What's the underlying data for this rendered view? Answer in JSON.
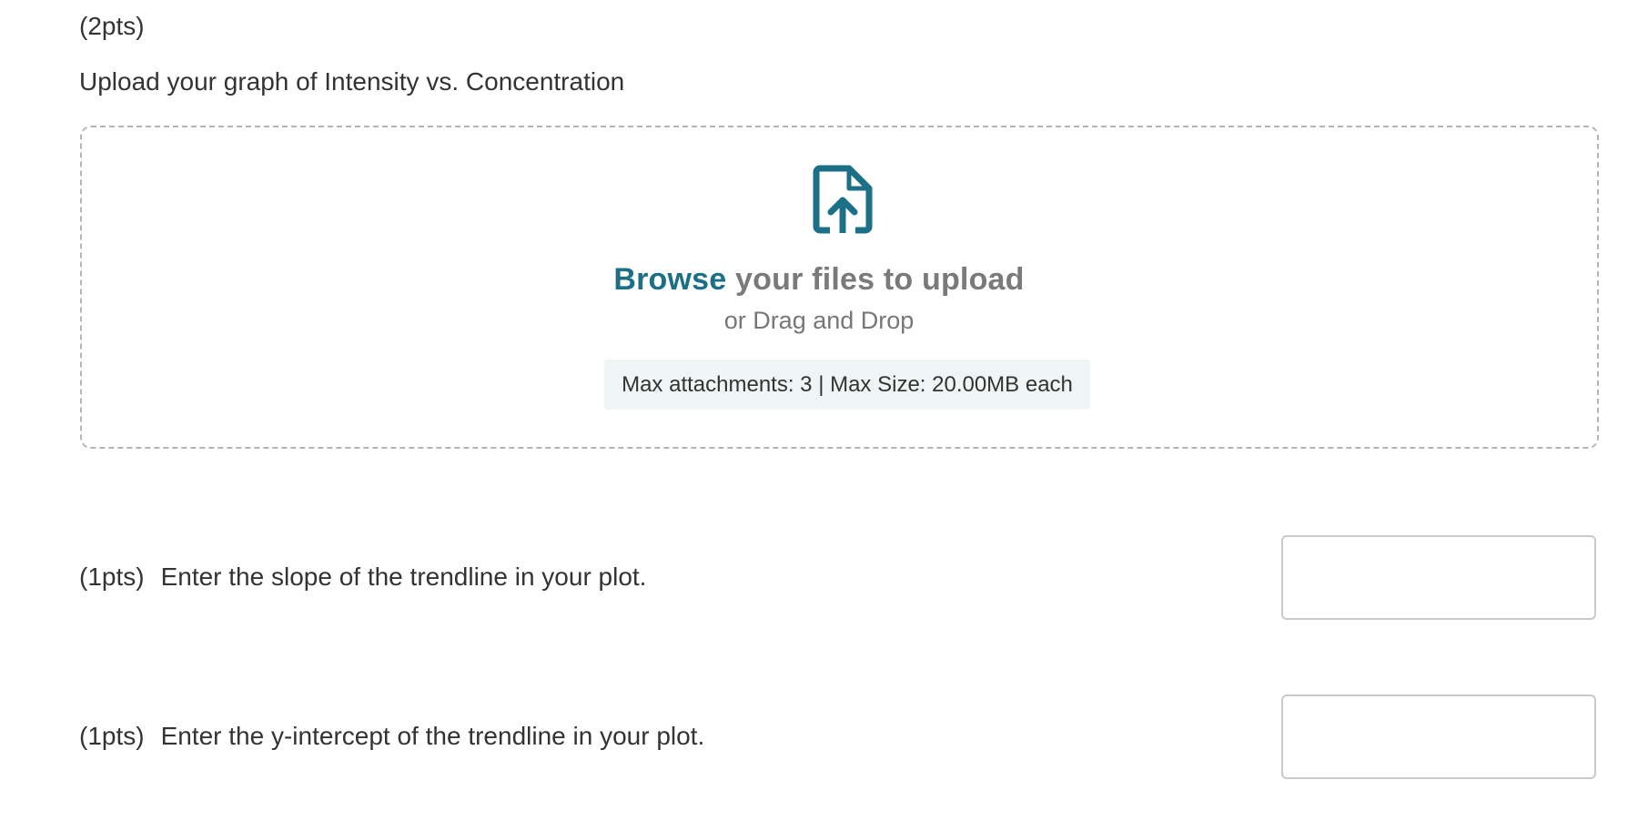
{
  "upload_question": {
    "points": "(2pts)",
    "prompt": "Upload your graph of Intensity vs. Concentration"
  },
  "dropzone": {
    "icon": "file-upload-icon",
    "browse_link": "Browse",
    "browse_rest": " your files to upload",
    "drag_drop": "or Drag and Drop",
    "limits": "Max attachments: 3 | Max Size: 20.00MB each",
    "accent_color": "#1b6f86"
  },
  "questions": [
    {
      "points": "(1pts)",
      "text": "Enter the slope of the trendline in your plot.",
      "answer_value": ""
    },
    {
      "points": "(1pts)",
      "text": "Enter the y-intercept of the trendline in your plot.",
      "answer_value": ""
    }
  ]
}
